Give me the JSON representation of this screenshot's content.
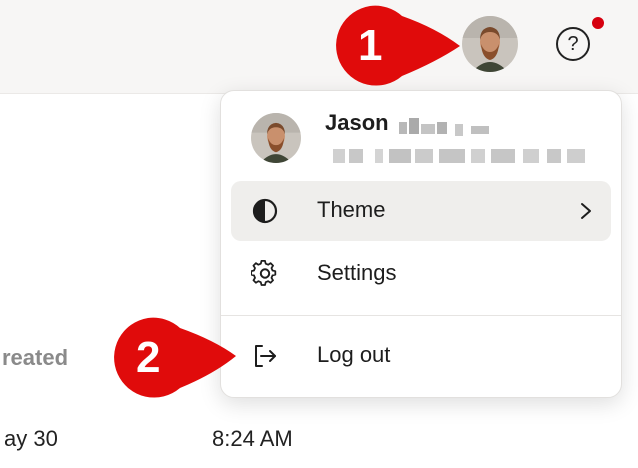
{
  "topbar": {
    "avatar_icon": "user-avatar",
    "help_label": "?",
    "help_icon": "help-circle-icon",
    "notification_color": "#d6000f"
  },
  "background": {
    "table_header_fragment": "reated",
    "row_date_fragment": "ay 30",
    "row_time": "8:24 AM"
  },
  "menu": {
    "user_name": "Jason",
    "items": [
      {
        "label": "Theme",
        "icon": "half-circle-theme-icon",
        "has_submenu": true
      },
      {
        "label": "Settings",
        "icon": "gear-icon"
      },
      {
        "label": "Log out",
        "icon": "log-out-icon"
      }
    ]
  },
  "callouts": [
    {
      "number": "1",
      "color": "#e00b0b"
    },
    {
      "number": "2",
      "color": "#e00b0b"
    }
  ]
}
